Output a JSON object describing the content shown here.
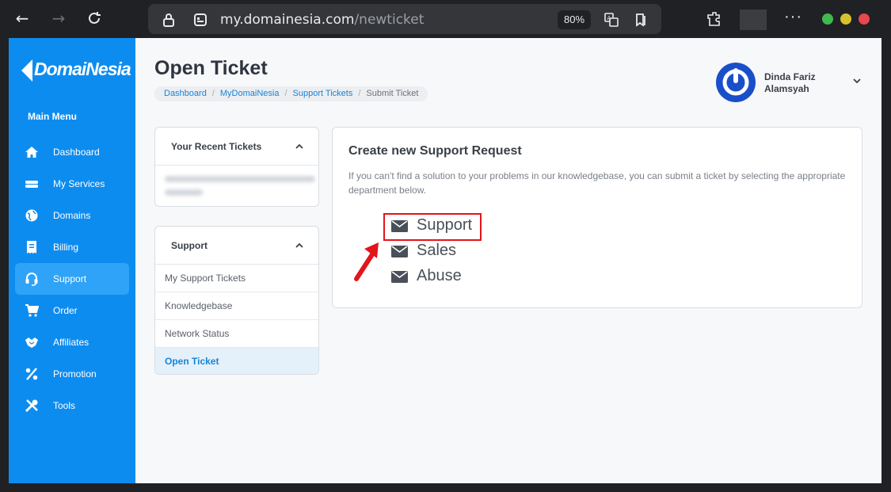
{
  "browser": {
    "url_host": "my.domainesia.com",
    "url_path": "/newticket",
    "zoom": "80%"
  },
  "sidebar": {
    "logo": "DomaiNesia",
    "main_menu_label": "Main Menu",
    "items": [
      {
        "label": "Dashboard",
        "icon": "home-icon"
      },
      {
        "label": "My Services",
        "icon": "server-icon"
      },
      {
        "label": "Domains",
        "icon": "globe-icon"
      },
      {
        "label": "Billing",
        "icon": "receipt-icon"
      },
      {
        "label": "Support",
        "icon": "headset-icon",
        "active": true
      },
      {
        "label": "Order",
        "icon": "cart-icon"
      },
      {
        "label": "Affiliates",
        "icon": "handshake-icon"
      },
      {
        "label": "Promotion",
        "icon": "percent-icon"
      },
      {
        "label": "Tools",
        "icon": "tools-icon"
      }
    ]
  },
  "header": {
    "title": "Open Ticket",
    "breadcrumb": [
      "Dashboard",
      "MyDomaiNesia",
      "Support Tickets",
      "Submit Ticket"
    ],
    "user_name_line1": "Dinda Fariz",
    "user_name_line2": "Alamsyah"
  },
  "recent_tickets": {
    "title": "Your Recent Tickets"
  },
  "support_panel": {
    "title": "Support",
    "items": [
      "My Support Tickets",
      "Knowledgebase",
      "Network Status",
      "Open Ticket"
    ]
  },
  "request": {
    "title": "Create new Support Request",
    "description": "If you can't find a solution to your problems in our knowledgebase, you can submit a ticket by selecting the appropriate department below.",
    "departments": [
      "Support",
      "Sales",
      "Abuse"
    ]
  },
  "colors": {
    "sidebar": "#0d8cf0",
    "link": "#1685d8",
    "highlight": "#e4141b"
  }
}
